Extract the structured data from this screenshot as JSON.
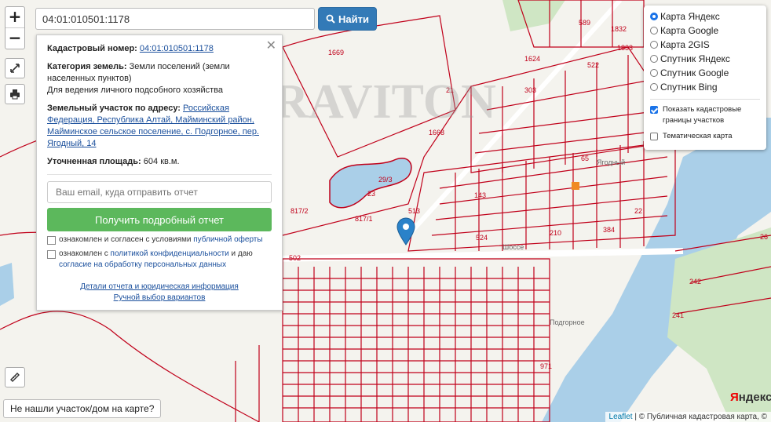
{
  "search": {
    "value": "04:01:010501:1178",
    "button_label": "Найти"
  },
  "zoom": {
    "in_label": "+",
    "out_label": "−"
  },
  "info": {
    "cad_label": "Кадастровый номер:",
    "cad_value": "04:01:010501:1178",
    "category_label": "Категория земель:",
    "category_value": "Земли поселений (земли населенных пунктов)",
    "usage_value": "Для ведения личного подсобного хозяйства",
    "address_label": "Земельный участок по адресу:",
    "address_value": "Российская Федерация, Республика Алтай, Майминский район, Майминское сельское поселение, с. Подгорное, пер. Ягодный, 14",
    "area_label": "Уточненная площадь:",
    "area_value": "604 кв.м.",
    "email_placeholder": "Ваш email, куда отправить отчет",
    "report_button": "Получить подробный отчет",
    "agree1_prefix": "ознакомлен и согласен с условиями",
    "agree1_link": "публичной оферты",
    "agree2_prefix": "ознакомлен с",
    "agree2_link1": "политикой конфиденциальности",
    "agree2_mid": "и даю",
    "agree2_link2": "согласие на обработку персональных данных",
    "details_link": "Детали отчета и юридическая информация",
    "manual_link": "Ручной выбор вариантов"
  },
  "layers": {
    "options": [
      "Карта Яндекс",
      "Карта Google",
      "Карта 2GIS",
      "Спутник Яндекс",
      "Спутник Google",
      "Спутник Bing"
    ],
    "selected": "Карта Яндекс",
    "cadastral_borders": "Показать кадастровые границы участков",
    "thematic": "Тематическая карта"
  },
  "map_labels": {
    "watermark": "GRAVITON",
    "parcels": [
      "1669",
      "1668",
      "589",
      "1832",
      "1833",
      "1624",
      "522",
      "21",
      "303",
      "29/3",
      "23",
      "817/2",
      "817/1",
      "513",
      "143",
      "524",
      "210",
      "384",
      "22",
      "65",
      "502",
      "242",
      "241",
      "26",
      "971"
    ],
    "places": [
      "Ягодный",
      "Шоссе",
      "Подгорное"
    ]
  },
  "not_found": "Не нашли участок/дом на карте?",
  "attribution": {
    "leaflet": "Leaflet",
    "text": "| © Публичная кадастровая карта, ©"
  },
  "yandex_logo": {
    "first": "Я",
    "rest": "ндекс"
  }
}
